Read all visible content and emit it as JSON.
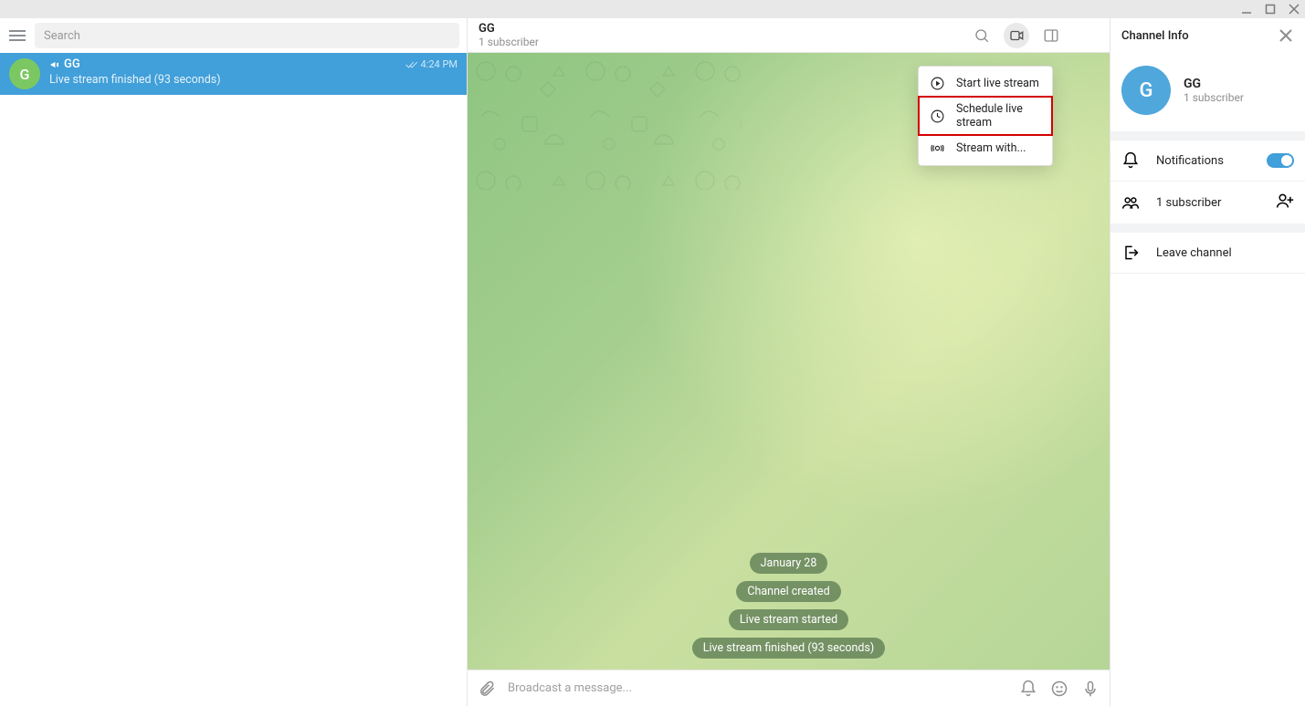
{
  "search": {
    "placeholder": "Search"
  },
  "chat_list": {
    "items": [
      {
        "avatar_initial": "G",
        "name": "GG",
        "preview": "Live stream finished (93 seconds)",
        "time": "4:24 PM"
      }
    ]
  },
  "chat_header": {
    "title": "GG",
    "subtitle": "1 subscriber"
  },
  "dropdown": {
    "items": [
      {
        "label": "Start live stream"
      },
      {
        "label": "Schedule live stream"
      },
      {
        "label": "Stream with..."
      }
    ]
  },
  "messages": {
    "date_pill": "January 28",
    "service_1": "Channel created",
    "service_2": "Live stream started",
    "service_3": "Live stream finished (93 seconds)"
  },
  "composer": {
    "placeholder": "Broadcast a message..."
  },
  "info_panel": {
    "title": "Channel Info",
    "avatar_initial": "G",
    "name": "GG",
    "subtitle": "1 subscriber",
    "notifications_label": "Notifications",
    "subscribers_label": "1 subscriber",
    "leave_label": "Leave channel"
  }
}
